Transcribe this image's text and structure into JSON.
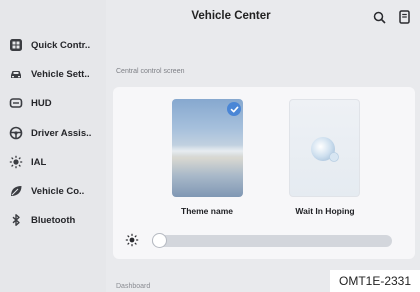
{
  "header": {
    "title": "Vehicle Center"
  },
  "sidebar": {
    "items": [
      {
        "label": "Quick Contr..",
        "icon": "quick-control-icon"
      },
      {
        "label": "Vehicle Sett..",
        "icon": "car-icon"
      },
      {
        "label": "HUD",
        "icon": "hud-icon"
      },
      {
        "label": "Driver Assis..",
        "icon": "steering-wheel-icon"
      },
      {
        "label": "IAL",
        "icon": "light-icon"
      },
      {
        "label": "Vehicle Co..",
        "icon": "leaf-icon"
      },
      {
        "label": "Bluetooth",
        "icon": "bluetooth-icon"
      }
    ]
  },
  "main": {
    "section_label": "Central control screen",
    "themes": [
      {
        "name": "Theme name",
        "selected": true
      },
      {
        "name": "Wait In Hoping",
        "selected": false
      }
    ],
    "brightness_level": 0.0,
    "next_section_label": "Dashboard"
  },
  "watermark": "OMT1E-2331",
  "colors": {
    "accent": "#4a86d6",
    "panel": "#f7f7f9",
    "background": "#e9eaed"
  }
}
